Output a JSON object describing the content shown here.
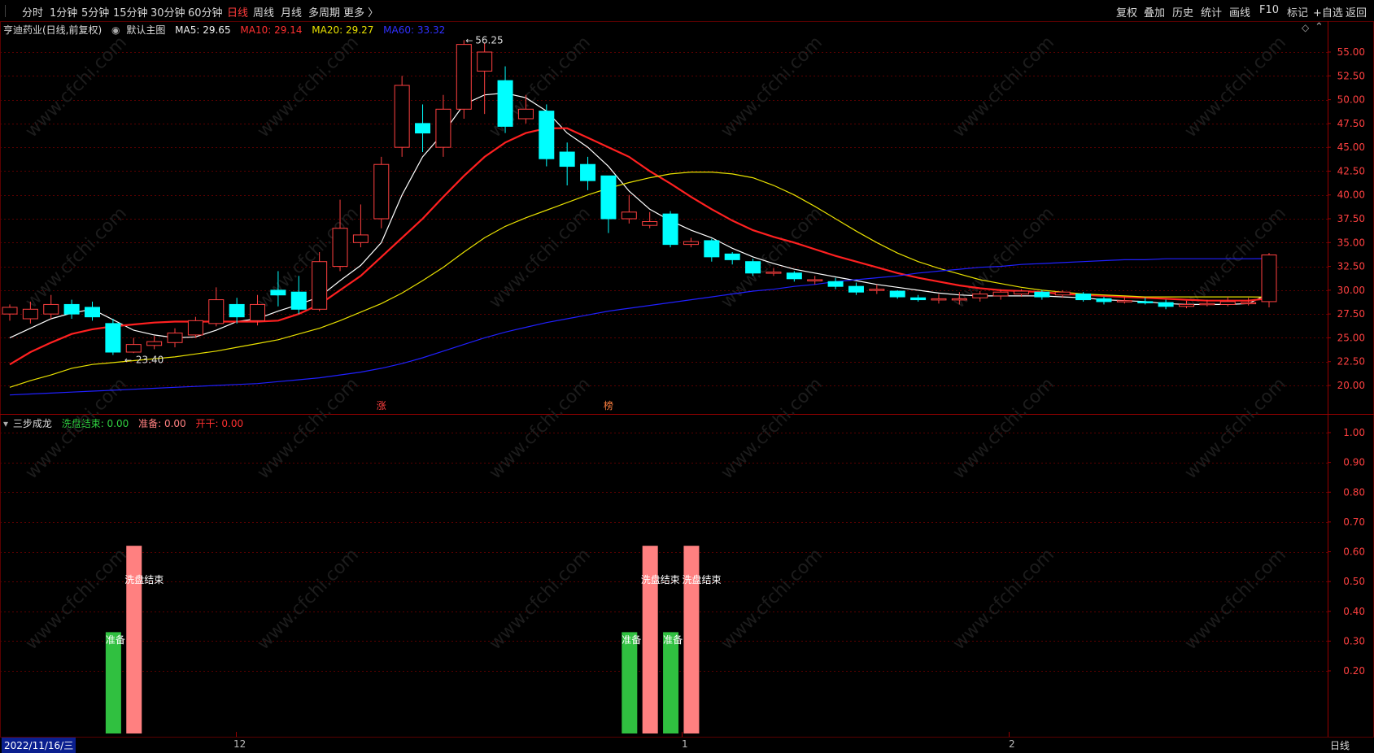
{
  "toolbar": {
    "periods": [
      "分时",
      "1分钟",
      "5分钟",
      "15分钟",
      "30分钟",
      "60分钟",
      "日线",
      "周线",
      "月线",
      "多周期",
      "更多 〉"
    ],
    "active_period": "日线",
    "right_buttons": [
      "复权",
      "叠加",
      "历史",
      "统计",
      "画线",
      "F10",
      "标记",
      "+自选",
      "返回"
    ]
  },
  "main_legend": {
    "stock": "亨迪药业(日线,前复权)",
    "template": "默认主图",
    "ma5": "MA5: 29.65",
    "ma10": "MA10: 29.14",
    "ma20": "MA20: 29.27",
    "ma60": "MA60: 33.32"
  },
  "sub_legend": {
    "name": "三步成龙",
    "s1": "洗盘结束: 0.00",
    "s2": "准备: 0.00",
    "s3": "开干: 0.00"
  },
  "colors": {
    "up": "#ff4040",
    "down": "#00ffff",
    "ma5": "#ffffff",
    "ma10": "#ff2020",
    "ma20": "#e8e000",
    "ma60": "#2020ff",
    "wash": "#ff8080",
    "ready": "#30c040",
    "grid": "#5a0000"
  },
  "annotations": {
    "high_label": "56.25",
    "low_label": "23.40",
    "mark1": "涨",
    "mark2": "榜",
    "watermark": "www.cfchi.com"
  },
  "status": {
    "date": "2022/11/16/三",
    "x_labels": [
      "12",
      "1",
      "2"
    ],
    "period_label": "日线"
  },
  "chart_data": [
    {
      "type": "candlestick",
      "title": "亨迪药业(日线,前复权)",
      "ylim": [
        18.75,
        56.25
      ],
      "y_ticks": [
        "55.00",
        "52.50",
        "50.00",
        "47.50",
        "45.00",
        "42.50",
        "40.00",
        "37.50",
        "35.00",
        "32.50",
        "30.00",
        "27.50",
        "25.00",
        "22.50",
        "20.00"
      ],
      "candles": [
        [
          27.5,
          28.2,
          26.8,
          28.5
        ],
        [
          27.0,
          28.0,
          26.5,
          28.8
        ],
        [
          27.5,
          28.5,
          27.0,
          29.5
        ],
        [
          28.5,
          27.5,
          27.0,
          29.0
        ],
        [
          28.2,
          27.2,
          26.8,
          28.8
        ],
        [
          26.5,
          23.5,
          23.2,
          27.0
        ],
        [
          23.5,
          24.3,
          23.4,
          25.0
        ],
        [
          24.2,
          24.6,
          23.8,
          25.2
        ],
        [
          24.5,
          25.5,
          24.0,
          26.0
        ],
        [
          25.3,
          26.8,
          25.0,
          27.2
        ],
        [
          26.5,
          29.0,
          26.2,
          30.3
        ],
        [
          28.5,
          27.2,
          26.5,
          29.2
        ],
        [
          26.8,
          28.5,
          26.3,
          29.5
        ],
        [
          30.0,
          29.5,
          28.3,
          32.0
        ],
        [
          29.8,
          28.0,
          27.5,
          31.5
        ],
        [
          28.0,
          33.0,
          27.8,
          34.0
        ],
        [
          32.5,
          36.5,
          32.0,
          39.5
        ],
        [
          35.0,
          35.8,
          34.5,
          39.0
        ],
        [
          37.5,
          43.2,
          36.5,
          44.0
        ],
        [
          45.0,
          51.5,
          44.0,
          52.5
        ],
        [
          47.5,
          46.5,
          44.5,
          49.5
        ],
        [
          45.0,
          49.0,
          44.0,
          50.5
        ],
        [
          49.0,
          55.8,
          48.0,
          56.25
        ],
        [
          53.0,
          55.0,
          48.5,
          56.0
        ],
        [
          52.0,
          47.2,
          46.5,
          53.5
        ],
        [
          48.0,
          49.0,
          47.5,
          50.5
        ],
        [
          48.8,
          43.8,
          43.0,
          49.5
        ],
        [
          44.5,
          43.0,
          41.0,
          45.5
        ],
        [
          43.2,
          41.5,
          40.5,
          44.0
        ],
        [
          42.0,
          37.5,
          36.0,
          42.0
        ],
        [
          37.5,
          38.2,
          37.0,
          40.0
        ],
        [
          36.8,
          37.2,
          36.5,
          38.2
        ],
        [
          38.0,
          34.8,
          34.5,
          38.3
        ],
        [
          34.8,
          35.1,
          34.5,
          35.5
        ],
        [
          35.2,
          33.5,
          33.0,
          35.4
        ],
        [
          33.8,
          33.2,
          32.7,
          34.0
        ],
        [
          33.0,
          31.8,
          31.5,
          33.3
        ],
        [
          31.9,
          31.9,
          31.5,
          32.3
        ],
        [
          31.8,
          31.2,
          30.9,
          32.0
        ],
        [
          31.0,
          31.1,
          30.6,
          31.5
        ],
        [
          30.9,
          30.4,
          30.1,
          31.3
        ],
        [
          30.4,
          29.8,
          29.5,
          30.8
        ],
        [
          30.1,
          30.1,
          29.6,
          30.6
        ],
        [
          29.9,
          29.3,
          29.1,
          30.0
        ],
        [
          29.2,
          29.0,
          28.8,
          29.5
        ],
        [
          29.0,
          29.1,
          28.6,
          29.6
        ],
        [
          29.0,
          29.1,
          28.5,
          29.8
        ],
        [
          29.2,
          29.6,
          28.8,
          29.9
        ],
        [
          29.4,
          29.8,
          29.0,
          30.1
        ],
        [
          29.6,
          29.9,
          29.3,
          30.1
        ],
        [
          29.8,
          29.3,
          29.0,
          30.0
        ],
        [
          29.5,
          29.8,
          29.2,
          30.0
        ],
        [
          29.6,
          29.0,
          28.8,
          29.8
        ],
        [
          29.1,
          28.8,
          28.5,
          29.3
        ],
        [
          28.9,
          28.9,
          28.6,
          29.3
        ],
        [
          28.8,
          28.7,
          28.5,
          29.2
        ],
        [
          28.7,
          28.3,
          28.0,
          29.0
        ],
        [
          28.3,
          28.5,
          28.1,
          28.9
        ],
        [
          28.6,
          28.6,
          28.3,
          29.0
        ],
        [
          28.5,
          28.8,
          28.3,
          29.3
        ],
        [
          28.6,
          28.7,
          28.4,
          29.2
        ],
        [
          28.8,
          33.7,
          28.2,
          33.9
        ]
      ],
      "series": [
        {
          "name": "MA5",
          "values": [
            25.0,
            26.0,
            27.0,
            27.6,
            28.0,
            26.9,
            25.8,
            25.3,
            25.0,
            25.1,
            25.8,
            26.7,
            27.0,
            27.8,
            28.5,
            29.3,
            31.0,
            32.6,
            35.0,
            40.0,
            44.0,
            46.5,
            49.5,
            50.5,
            50.7,
            50.2,
            48.8,
            46.5,
            45.0,
            43.0,
            40.4,
            38.5,
            37.3,
            36.3,
            35.5,
            34.4,
            33.5,
            32.8,
            32.2,
            31.8,
            31.4,
            31.0,
            30.6,
            30.3,
            30.0,
            29.7,
            29.5,
            29.4,
            29.4,
            29.4,
            29.4,
            29.3,
            29.2,
            29.0,
            28.9,
            28.8,
            28.6,
            28.5,
            28.5,
            28.5,
            28.6,
            29.65
          ]
        },
        {
          "name": "MA10",
          "values": [
            22.2,
            23.5,
            24.5,
            25.4,
            25.9,
            26.2,
            26.4,
            26.6,
            26.7,
            26.7,
            26.7,
            26.7,
            26.7,
            26.8,
            27.5,
            28.5,
            30.0,
            31.5,
            33.5,
            35.5,
            37.5,
            39.8,
            42.0,
            44.0,
            45.5,
            46.5,
            47.0,
            47.0,
            46.0,
            45.0,
            44.0,
            42.5,
            41.2,
            39.8,
            38.5,
            37.3,
            36.3,
            35.6,
            35.0,
            34.3,
            33.6,
            33.0,
            32.4,
            31.8,
            31.3,
            30.9,
            30.5,
            30.2,
            30.0,
            29.9,
            29.8,
            29.6,
            29.5,
            29.4,
            29.3,
            29.2,
            29.1,
            29.0,
            28.9,
            28.9,
            28.9,
            29.14
          ]
        },
        {
          "name": "MA20",
          "values": [
            19.8,
            20.5,
            21.1,
            21.8,
            22.2,
            22.4,
            22.6,
            22.8,
            23.0,
            23.3,
            23.6,
            24.0,
            24.4,
            24.8,
            25.4,
            26.0,
            26.8,
            27.7,
            28.6,
            29.7,
            31.0,
            32.4,
            34.0,
            35.5,
            36.7,
            37.6,
            38.4,
            39.2,
            40.0,
            40.7,
            41.3,
            41.8,
            42.2,
            42.4,
            42.4,
            42.2,
            41.8,
            41.0,
            40.0,
            38.8,
            37.5,
            36.2,
            35.0,
            33.9,
            33.0,
            32.3,
            31.7,
            31.1,
            30.7,
            30.3,
            30.0,
            29.8,
            29.6,
            29.5,
            29.4,
            29.3,
            29.3,
            29.3,
            29.3,
            29.3,
            29.3,
            29.27
          ]
        },
        {
          "name": "MA60",
          "values": [
            19.0,
            19.1,
            19.2,
            19.3,
            19.4,
            19.5,
            19.6,
            19.7,
            19.8,
            19.9,
            20.0,
            20.1,
            20.2,
            20.4,
            20.6,
            20.8,
            21.1,
            21.4,
            21.8,
            22.3,
            22.9,
            23.6,
            24.3,
            25.0,
            25.6,
            26.1,
            26.6,
            27.0,
            27.4,
            27.8,
            28.1,
            28.4,
            28.7,
            29.0,
            29.3,
            29.6,
            29.9,
            30.1,
            30.4,
            30.6,
            30.9,
            31.1,
            31.3,
            31.5,
            31.8,
            32.0,
            32.2,
            32.4,
            32.5,
            32.7,
            32.8,
            32.9,
            33.0,
            33.1,
            33.2,
            33.2,
            33.3,
            33.3,
            33.3,
            33.3,
            33.3,
            33.32
          ]
        }
      ]
    },
    {
      "type": "bar",
      "title": "三步成龙",
      "ylim": [
        0,
        1.05
      ],
      "y_ticks": [
        "1.00",
        "0.90",
        "0.80",
        "0.70",
        "0.60",
        "0.50",
        "0.40",
        "0.30",
        "0.20"
      ],
      "bars": [
        {
          "index": 5,
          "value": 0.33,
          "series": "准备",
          "label": "准备"
        },
        {
          "index": 6,
          "value": 0.62,
          "series": "洗盘结束",
          "label": "洗盘结束"
        },
        {
          "index": 30,
          "value": 0.33,
          "series": "准备",
          "label": "准备"
        },
        {
          "index": 31,
          "value": 0.62,
          "series": "洗盘结束",
          "label": "洗盘结束"
        },
        {
          "index": 32,
          "value": 0.33,
          "series": "准备",
          "label": "准备"
        },
        {
          "index": 33,
          "value": 0.62,
          "series": "洗盘结束",
          "label": "洗盘结束"
        }
      ]
    }
  ]
}
